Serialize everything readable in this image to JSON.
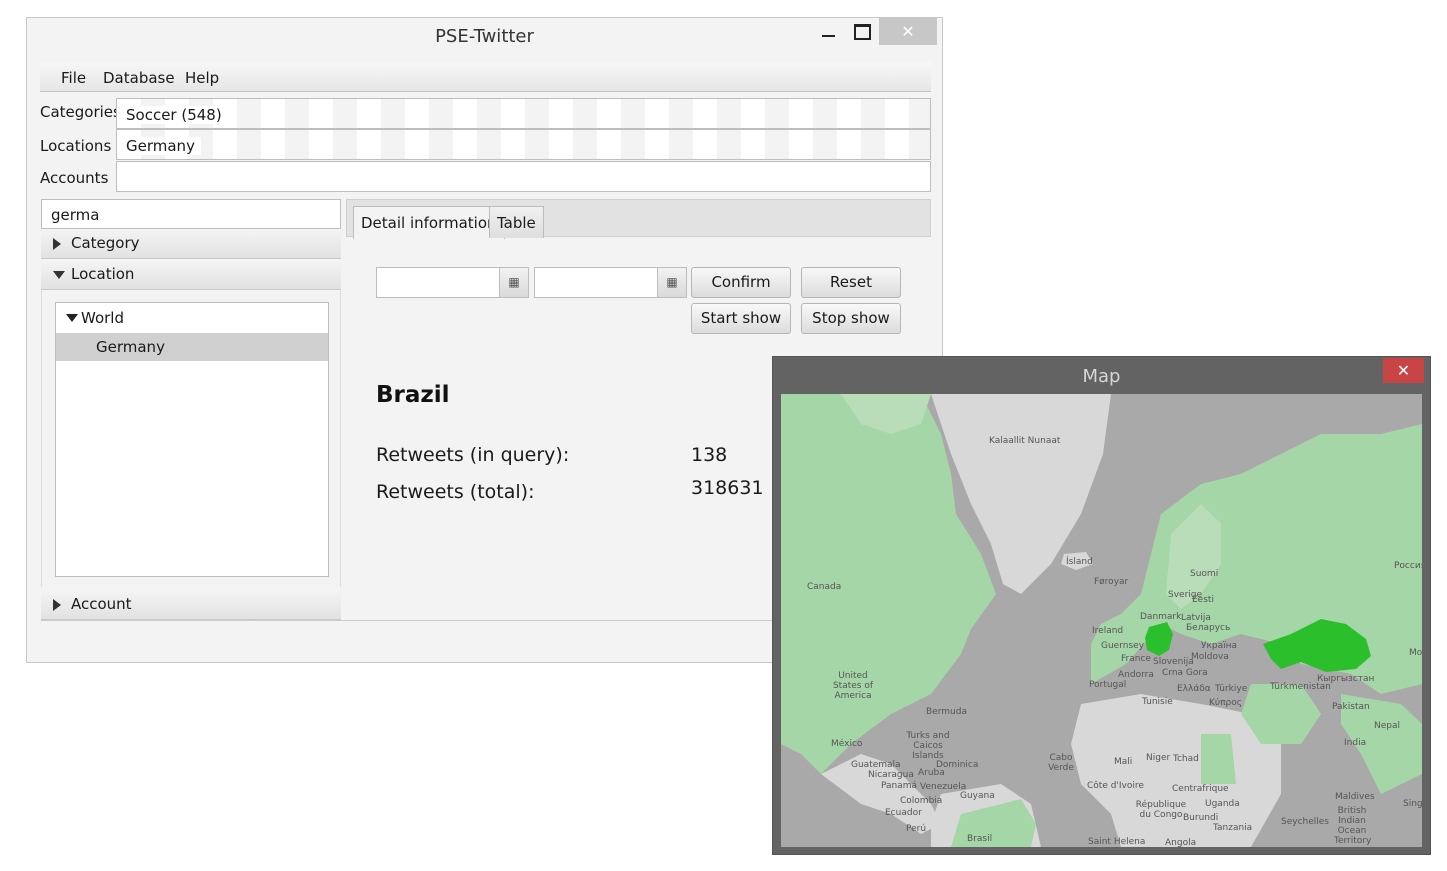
{
  "main_window": {
    "title": "PSE-Twitter",
    "close_symbol": "✕"
  },
  "menu": [
    "File",
    "Database",
    "Help"
  ],
  "filters": {
    "categories": {
      "label": "Categories",
      "value": "Soccer (548)"
    },
    "locations": {
      "label": "Locations",
      "value": "Germany"
    },
    "accounts": {
      "label": "Accounts",
      "value": ""
    }
  },
  "left_panel": {
    "search_value": "germa",
    "sections": [
      "Category",
      "Location",
      "Account"
    ],
    "tree": {
      "root": "World",
      "child": "Germany"
    }
  },
  "tabs": [
    "Detail information",
    "Table"
  ],
  "controls": {
    "calendar_symbol": "▦",
    "confirm": "Confirm",
    "reset": "Reset",
    "start_show": "Start show",
    "stop_show": "Stop show"
  },
  "detail": {
    "title": "Brazil",
    "rows": [
      {
        "label": "Retweets (in query):",
        "value": "138"
      },
      {
        "label": "Retweets (total):",
        "value": "318631"
      }
    ]
  },
  "map_window": {
    "title": "Map",
    "close_symbol": "✕",
    "colors": {
      "land": "#d9d9d9",
      "sea": "#a9a9a9",
      "light_green": "#a5d6a7",
      "highlight_green": "#2cbf2c"
    },
    "labels": [
      "Kalaallit Nunaat",
      "Canada",
      "Ísland",
      "Føroyar",
      "Suomi",
      "Sverige",
      "Eesti",
      "Danmark",
      "Latvija",
      "Беларусь",
      "Ireland",
      "Guernsey",
      "France",
      "Україна",
      "Moldova",
      "Andorra",
      "Slovenija",
      "Crna Gora",
      "Portugal",
      "Ελλάδα",
      "Türkiye",
      "Κύπρος",
      "Tunisie",
      "Россия",
      "Türkmenistan",
      "Кыргызстан",
      "Pakistan",
      "Nepal",
      "India",
      "United States of America",
      "Bermuda",
      "México",
      "Turks and Caicos Islands",
      "Dominica",
      "Guatemala",
      "Nicaragua",
      "Panamá",
      "Aruba",
      "Venezuela",
      "Guyana",
      "Colombia",
      "Ecuador",
      "Perú",
      "Brasil",
      "Cabo Verde",
      "Mali",
      "Niger",
      "Tchad",
      "Côte d'Ivoire",
      "Centrafrique",
      "République du Congo",
      "Uganda",
      "Burundi",
      "Tanzania",
      "Seychelles",
      "Maldives",
      "British Indian Ocean Territory",
      "Saint Helena",
      "Angola",
      "Mo",
      "Sing"
    ]
  }
}
